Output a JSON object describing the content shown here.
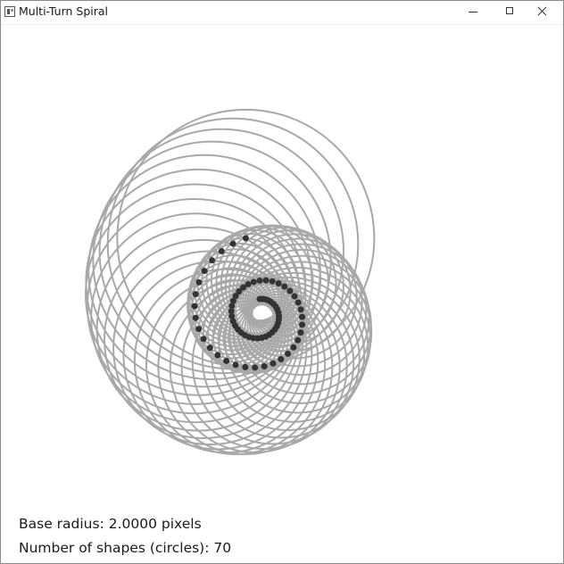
{
  "window": {
    "title": "Multi-Turn Spiral",
    "app_icon": "app-window-icon",
    "controls": {
      "minimize_icon": "minimize-icon",
      "maximize_icon": "maximize-icon",
      "close_icon": "close-icon"
    }
  },
  "info": {
    "base_radius_text": "Base radius: 2.0000 pixels",
    "shape_count_text": "Number of shapes (circles): 70"
  },
  "drawing": {
    "shape": "circle",
    "count": 70,
    "base_radius": 2.0,
    "circle_stroke_color": "#a8a8a8",
    "center_dot_color": "#333333"
  }
}
